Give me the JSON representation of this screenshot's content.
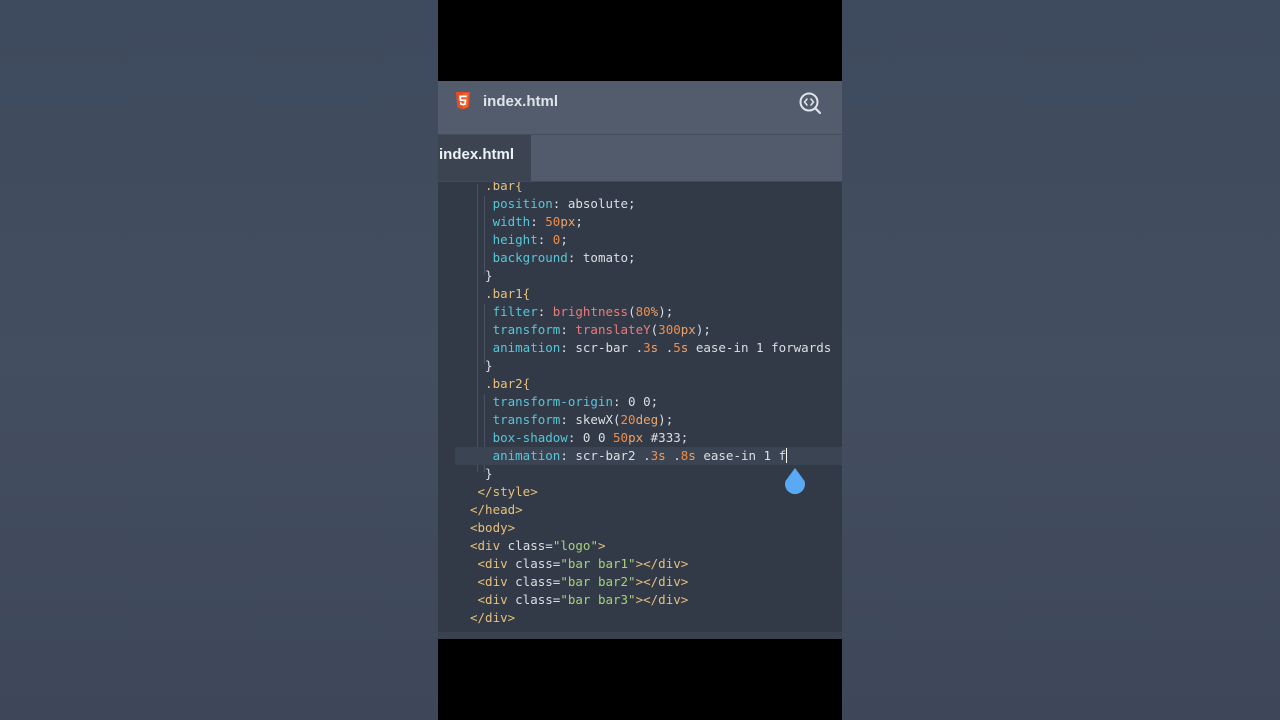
{
  "header": {
    "file_icon": "html5-icon",
    "title": "index.html",
    "preview_icon": "code-preview-icon"
  },
  "tabs": [
    {
      "label": "index.html",
      "active": true
    }
  ],
  "editor": {
    "lines": [
      [
        [
          "  .bar{",
          "sel"
        ]
      ],
      [
        [
          "   ",
          "val"
        ],
        [
          "position",
          "prop"
        ],
        [
          ": absolute;",
          "val"
        ]
      ],
      [
        [
          "   ",
          "val"
        ],
        [
          "width",
          "prop"
        ],
        [
          ": ",
          "val"
        ],
        [
          "50",
          "num"
        ],
        [
          "px",
          "unit"
        ],
        [
          ";",
          "val"
        ]
      ],
      [
        [
          "   ",
          "val"
        ],
        [
          "height",
          "prop"
        ],
        [
          ": ",
          "val"
        ],
        [
          "0",
          "num"
        ],
        [
          ";",
          "val"
        ]
      ],
      [
        [
          "   ",
          "val"
        ],
        [
          "background",
          "prop"
        ],
        [
          ": tomato;",
          "val"
        ]
      ],
      [
        [
          "  }",
          "punc"
        ]
      ],
      [
        [
          "  .bar1{",
          "sel"
        ]
      ],
      [
        [
          "   ",
          "val"
        ],
        [
          "filter",
          "prop"
        ],
        [
          ": ",
          "val"
        ],
        [
          "brightness",
          "fn"
        ],
        [
          "(",
          "val"
        ],
        [
          "80",
          "num"
        ],
        [
          "%",
          "unit"
        ],
        [
          ");",
          "val"
        ]
      ],
      [
        [
          "   ",
          "val"
        ],
        [
          "transform",
          "prop"
        ],
        [
          ": ",
          "val"
        ],
        [
          "translateY",
          "fn"
        ],
        [
          "(",
          "val"
        ],
        [
          "300",
          "num"
        ],
        [
          "px",
          "unit"
        ],
        [
          ");",
          "val"
        ]
      ],
      [
        [
          "   ",
          "val"
        ],
        [
          "animation",
          "prop"
        ],
        [
          ": scr-bar .",
          "val"
        ],
        [
          "3",
          "num"
        ],
        [
          "s",
          "unit"
        ],
        [
          " .",
          "val"
        ],
        [
          "5",
          "num"
        ],
        [
          "s",
          "unit"
        ],
        [
          " ease-in 1 forwards",
          "val"
        ]
      ],
      [
        [
          "  }",
          "punc"
        ]
      ],
      [
        [
          "  .bar2{",
          "sel"
        ]
      ],
      [
        [
          "   ",
          "val"
        ],
        [
          "transform-origin",
          "prop"
        ],
        [
          ": 0 0;",
          "val"
        ]
      ],
      [
        [
          "   ",
          "val"
        ],
        [
          "transform",
          "prop"
        ],
        [
          ": skewX(",
          "val"
        ],
        [
          "20",
          "num"
        ],
        [
          "deg",
          "unit"
        ],
        [
          ");",
          "val"
        ]
      ],
      [
        [
          "   ",
          "val"
        ],
        [
          "box-shadow",
          "prop"
        ],
        [
          ": 0 0 ",
          "val"
        ],
        [
          "50",
          "num"
        ],
        [
          "px",
          "unit"
        ],
        [
          " #333;",
          "val"
        ]
      ],
      [
        [
          "   ",
          "val"
        ],
        [
          "animation",
          "prop"
        ],
        [
          ": scr-bar2 .",
          "val"
        ],
        [
          "3",
          "num"
        ],
        [
          "s",
          "unit"
        ],
        [
          " .",
          "val"
        ],
        [
          "8",
          "num"
        ],
        [
          "s",
          "unit"
        ],
        [
          " ease-in 1 f",
          "val"
        ],
        [
          "|",
          "caret"
        ]
      ],
      [
        [
          "  }",
          "punc"
        ]
      ],
      [
        [
          " </style>",
          "tag"
        ]
      ],
      [
        [
          "</head>",
          "tag"
        ]
      ],
      [
        [
          "<body>",
          "tag"
        ]
      ],
      [
        [
          "<div ",
          "tag"
        ],
        [
          "class",
          "attr"
        ],
        [
          "=",
          "punc"
        ],
        [
          "\"logo\"",
          "str"
        ],
        [
          ">",
          "tag"
        ]
      ],
      [
        [
          " <div ",
          "tag"
        ],
        [
          "class",
          "attr"
        ],
        [
          "=",
          "punc"
        ],
        [
          "\"bar bar1\"",
          "str"
        ],
        [
          "></div>",
          "tag"
        ]
      ],
      [
        [
          " <div ",
          "tag"
        ],
        [
          "class",
          "attr"
        ],
        [
          "=",
          "punc"
        ],
        [
          "\"bar bar2\"",
          "str"
        ],
        [
          "></div>",
          "tag"
        ]
      ],
      [
        [
          " <div ",
          "tag"
        ],
        [
          "class",
          "attr"
        ],
        [
          "=",
          "punc"
        ],
        [
          "\"bar bar3\"",
          "str"
        ],
        [
          "></div>",
          "tag"
        ]
      ],
      [
        [
          "</div>",
          "tag"
        ]
      ]
    ],
    "current_line": 15,
    "cursor_handle": "drop-cursor-handle"
  }
}
